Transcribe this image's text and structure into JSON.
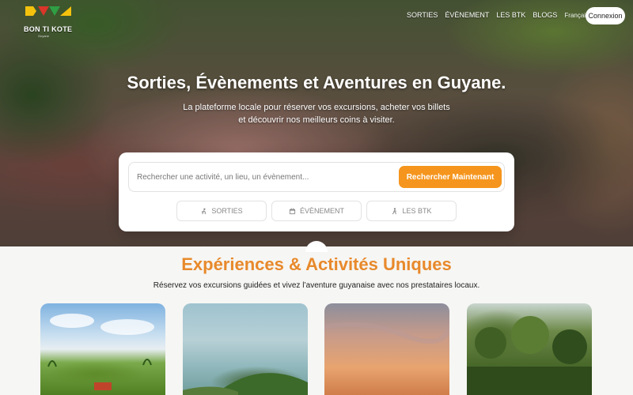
{
  "brand": {
    "logo_text": "BON TI KOTE",
    "logo_subtext": "Guyane",
    "colors": {
      "accent_orange": "#f5951d",
      "title_orange": "#e8892b",
      "logo_green": "#2f9e44",
      "logo_yellow": "#f4c20d",
      "logo_red": "#d9352a"
    }
  },
  "nav": {
    "links": [
      "SORTIES",
      "ÉVÈNEMENT",
      "LES BTK",
      "BLOGS"
    ],
    "language": "Français",
    "login_label": "Connexion"
  },
  "hero": {
    "title": "Sorties, Évènements et Aventures en Guyane.",
    "subtitle_line1": "La plateforme locale pour réserver vos excursions, acheter vos billets",
    "subtitle_line2": "et découvrir nos meilleurs coins à visiter."
  },
  "search": {
    "placeholder": "Rechercher une activité, un lieu, un évènement...",
    "button_label": "Rechercher Maintenant",
    "categories": [
      {
        "label": "SORTIES",
        "icon": "hiking-icon"
      },
      {
        "label": "ÉVÈNEMENT",
        "icon": "calendar-icon"
      },
      {
        "label": "LES BTK",
        "icon": "walking-person-icon"
      }
    ]
  },
  "section": {
    "title": "Expériences & Activités Uniques",
    "subtitle": "Réservez vos excursions guidées et vivez l’aventure guyanaise avec nos prestataires locaux."
  },
  "cards": [
    {
      "image": "tropical-village-sky"
    },
    {
      "image": "coastal-hill-sea"
    },
    {
      "image": "sunset-sky"
    },
    {
      "image": "rainforest-canopy"
    }
  ]
}
